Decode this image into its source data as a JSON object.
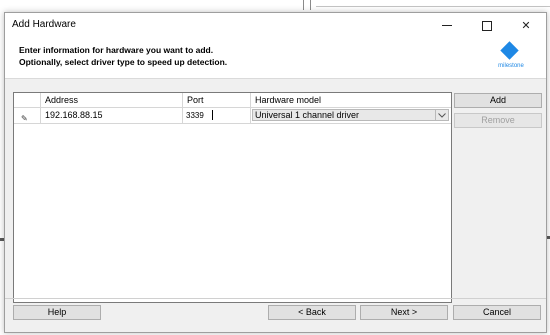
{
  "window": {
    "title": "Add Hardware",
    "minimize_icon": "minimize-icon",
    "maximize_icon": "maximize-icon",
    "close_icon": "close-icon",
    "close_glyph": "✕"
  },
  "header": {
    "line1": "Enter information for hardware you want to add.",
    "line2": "Optionally, select driver type to speed up detection.",
    "logo_text": "milestone",
    "logo_color": "#1e88e5"
  },
  "grid": {
    "columns": [
      "",
      "Address",
      "Port",
      "Hardware model"
    ],
    "rows": [
      {
        "edit_icon": "✎",
        "address": "192.168.88.15",
        "port": "3339",
        "model": "Universal 1 channel driver"
      }
    ]
  },
  "side_buttons": {
    "add": "Add",
    "remove": "Remove"
  },
  "footer": {
    "help": "Help",
    "back": "< Back",
    "next": "Next >",
    "cancel": "Cancel"
  }
}
